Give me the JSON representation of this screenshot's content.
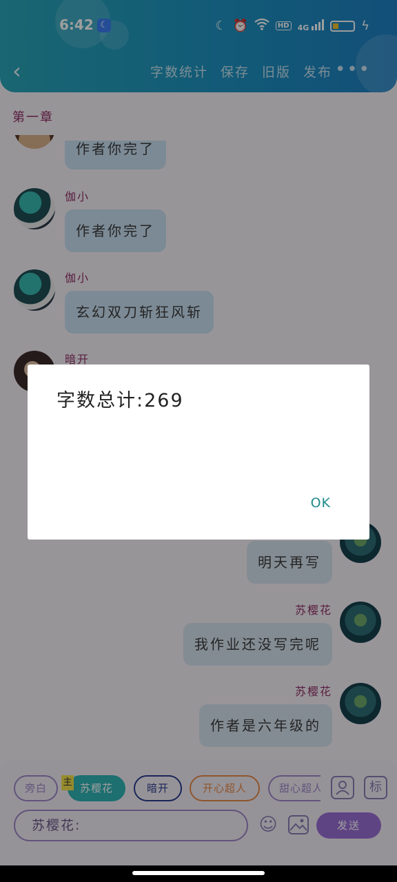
{
  "status_bar": {
    "time": "6:42",
    "icons": [
      "moon-icon",
      "alarm-icon",
      "wifi-icon",
      "hd-icon",
      "4g-signal-icon",
      "battery-icon",
      "charging-icon"
    ],
    "hd_label": "HD",
    "network_label": "4G"
  },
  "toolbar": {
    "back_icon": "back-chevron-icon",
    "word_count_label": "字数统计",
    "save_label": "保存",
    "old_version_label": "旧版",
    "publish_label": "发布",
    "more_icon": "more-dots-icon"
  },
  "chapter_title": "第一章",
  "messages": [
    {
      "name": "",
      "text": "作者你完了",
      "side": "left"
    },
    {
      "name": "伽小",
      "text": "作者你完了",
      "side": "left"
    },
    {
      "name": "伽小",
      "text": "玄幻双刀斩狂风斩",
      "side": "left"
    },
    {
      "name": "暗开",
      "text": "",
      "side": "left"
    },
    {
      "name": "",
      "text": "明天再写",
      "side": "right"
    },
    {
      "name": "苏樱花",
      "text": "我作业还没写完呢",
      "side": "right"
    },
    {
      "name": "苏樱花",
      "text": "作者是六年级的",
      "side": "right"
    }
  ],
  "characters": [
    {
      "label": "旁白",
      "color": "#9f86c8"
    },
    {
      "label": "苏樱花",
      "color": "#2fb3b5",
      "is_main": true,
      "main_tag": "主"
    },
    {
      "label": "暗开",
      "color": "#2a3d8f"
    },
    {
      "label": "开心超人",
      "color": "#e58a4a"
    },
    {
      "label": "甜心超人",
      "color": "#9f86c8"
    }
  ],
  "side_icons": [
    "person-icon",
    "tag-icon"
  ],
  "tag_icon_label": "标",
  "input": {
    "value": "苏樱花:"
  },
  "bottom_icons": [
    "emoji-icon",
    "image-icon"
  ],
  "send_label": "发送",
  "dialog": {
    "message": "字数总计:269",
    "ok_label": "OK"
  },
  "colors": {
    "header_start": "#2aa5b8",
    "header_end": "#1f80c3",
    "name_color": "#8e2f66",
    "send_button": "#9a6fd6",
    "dialog_ok": "#1e8a8a"
  }
}
